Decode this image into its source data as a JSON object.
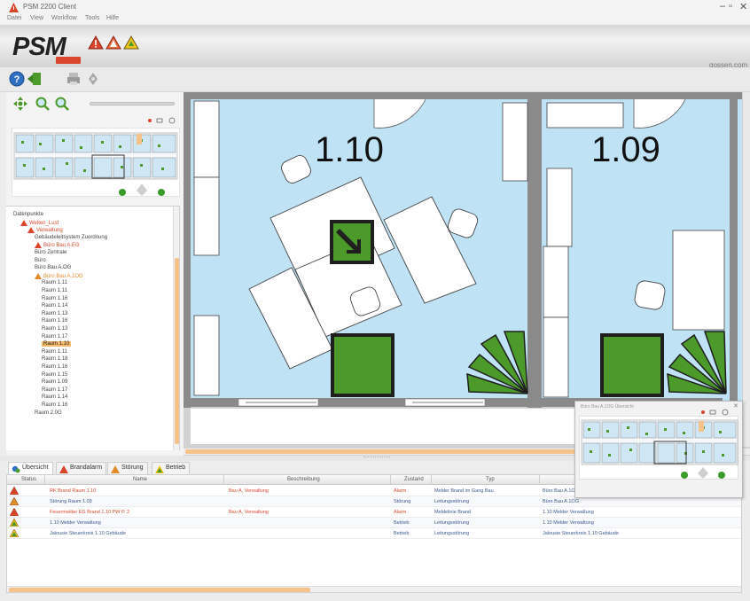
{
  "window": {
    "title": "PSM 2200 Client",
    "controls": {
      "minimize": "–",
      "maximize": "▫",
      "close": "✕"
    }
  },
  "menu": [
    "Datei",
    "View",
    "Workflow",
    "Tools",
    "Hilfe"
  ],
  "logo": {
    "text": "PSM",
    "brand": "gossen.com"
  },
  "colors": {
    "room_fill": "#bfe3f5",
    "wall": "#8a8a8a",
    "green_alarm": "#4c9a2a",
    "alarm_red": "#d9462c",
    "alarm_orange": "#e08b2c",
    "selection": "#f7b96a"
  },
  "toolbar": {
    "buttons": [
      "help-icon",
      "exit-icon",
      "print-icon",
      "settings-icon"
    ]
  },
  "navigator": {
    "tools": [
      "pan-icon",
      "zoom-in-icon",
      "zoom-out-icon"
    ]
  },
  "tree": {
    "items": [
      {
        "label": "Datenpunkte",
        "indent": 0,
        "style": "normal",
        "icon": ""
      },
      {
        "label": "Welten_Lust",
        "indent": 1,
        "style": "red",
        "icon": "alarm-red"
      },
      {
        "label": "Verwaltung",
        "indent": 2,
        "style": "red",
        "icon": "alarm-red"
      },
      {
        "label": "Gebäudeleitsystem Zuordnung",
        "indent": 3,
        "style": "normal",
        "icon": ""
      },
      {
        "label": "Büro Bau A.EG",
        "indent": 3,
        "style": "red",
        "icon": "alarm-red"
      },
      {
        "label": "Büro Zentrale",
        "indent": 3,
        "style": "normal",
        "icon": ""
      },
      {
        "label": "Büro",
        "indent": 3,
        "style": "normal",
        "icon": ""
      },
      {
        "label": "Büro Bau A.OG",
        "indent": 3,
        "style": "normal",
        "icon": ""
      },
      {
        "label": "Büro Bau A.1OG",
        "indent": 3,
        "style": "orange",
        "icon": "alarm-orange"
      },
      {
        "label": "Raum 1.11",
        "indent": 4,
        "style": "normal",
        "icon": ""
      },
      {
        "label": "Raum 1.11",
        "indent": 4,
        "style": "normal",
        "icon": ""
      },
      {
        "label": "Raum 1.16",
        "indent": 4,
        "style": "normal",
        "icon": ""
      },
      {
        "label": "Raum 1.14",
        "indent": 4,
        "style": "normal",
        "icon": ""
      },
      {
        "label": "Raum 1.13",
        "indent": 4,
        "style": "normal",
        "icon": ""
      },
      {
        "label": "Raum 1.16",
        "indent": 4,
        "style": "normal",
        "icon": ""
      },
      {
        "label": "Raum 1.13",
        "indent": 4,
        "style": "normal",
        "icon": ""
      },
      {
        "label": "Raum 1.17",
        "indent": 4,
        "style": "normal",
        "icon": ""
      },
      {
        "label": "Raum 1.10",
        "indent": 4,
        "style": "selected",
        "icon": ""
      },
      {
        "label": "Raum 1.11",
        "indent": 4,
        "style": "normal",
        "icon": ""
      },
      {
        "label": "Raum 1.18",
        "indent": 4,
        "style": "normal",
        "icon": ""
      },
      {
        "label": "Raum 1.16",
        "indent": 4,
        "style": "normal",
        "icon": ""
      },
      {
        "label": "Raum 1.15",
        "indent": 4,
        "style": "normal",
        "icon": ""
      },
      {
        "label": "Raum 1.09",
        "indent": 4,
        "style": "normal",
        "icon": ""
      },
      {
        "label": "Raum 1.17",
        "indent": 4,
        "style": "normal",
        "icon": ""
      },
      {
        "label": "Raum 1.14",
        "indent": 4,
        "style": "normal",
        "icon": ""
      },
      {
        "label": "Raum 1.16",
        "indent": 4,
        "style": "normal",
        "icon": ""
      },
      {
        "label": "Raum 2.0G",
        "indent": 3,
        "style": "normal",
        "icon": ""
      }
    ]
  },
  "floorplan": {
    "rooms": [
      {
        "number": "1.10"
      },
      {
        "number": "1.09"
      }
    ]
  },
  "alarm_tabs": [
    {
      "label": "Übersicht",
      "icon": "overview-icon",
      "active": true
    },
    {
      "label": "Brandalarm",
      "icon": "alarm-red",
      "active": false
    },
    {
      "label": "Störung",
      "icon": "alarm-orange",
      "active": false
    },
    {
      "label": "Betrieb",
      "icon": "alarm-green",
      "active": false
    }
  ],
  "alarm_table": {
    "columns": [
      "Status",
      "Name",
      "Beschreibung",
      "Zustand",
      "Typ",
      ""
    ],
    "rows": [
      {
        "status": "alarm-red",
        "name": "RK Brand Raum 1.10",
        "description": "Bau A, Verwaltung",
        "state": "Alarm",
        "type": "Melder Brand im Gang Bau",
        "extra": "Büro Bau A.1OG",
        "red": true
      },
      {
        "status": "alarm-orange",
        "name": "Störung Raum 1.09",
        "description": "",
        "state": "Störung",
        "type": "Leitungsstörung",
        "extra": "Büro Bau A.1OG",
        "red": false
      },
      {
        "status": "alarm-red",
        "name": "Feuermelder EG Brand 1.10 PW P. 2",
        "description": "Bau A, Verwaltung",
        "state": "Alarm",
        "type": "Meldelinie Brand",
        "extra": "1.10 Melder Verwaltung",
        "red": true
      },
      {
        "status": "alarm-green",
        "name": "1.10 Melder Verwaltung",
        "description": "",
        "state": "Betrieb",
        "type": "Leitungsstörung",
        "extra": "1.10 Melder Verwaltung",
        "red": false
      },
      {
        "status": "alarm-green",
        "name": "Jalousie Steuerkreis 1.10 Gebäude",
        "description": "",
        "state": "Betrieb",
        "type": "Leitungsstörung",
        "extra": "Jalousie Steuerkreis 1.10 Gebäude",
        "red": false
      }
    ]
  },
  "mini_window": {
    "title": "Büro Bau A.1OG Übersicht",
    "close": "✕"
  }
}
